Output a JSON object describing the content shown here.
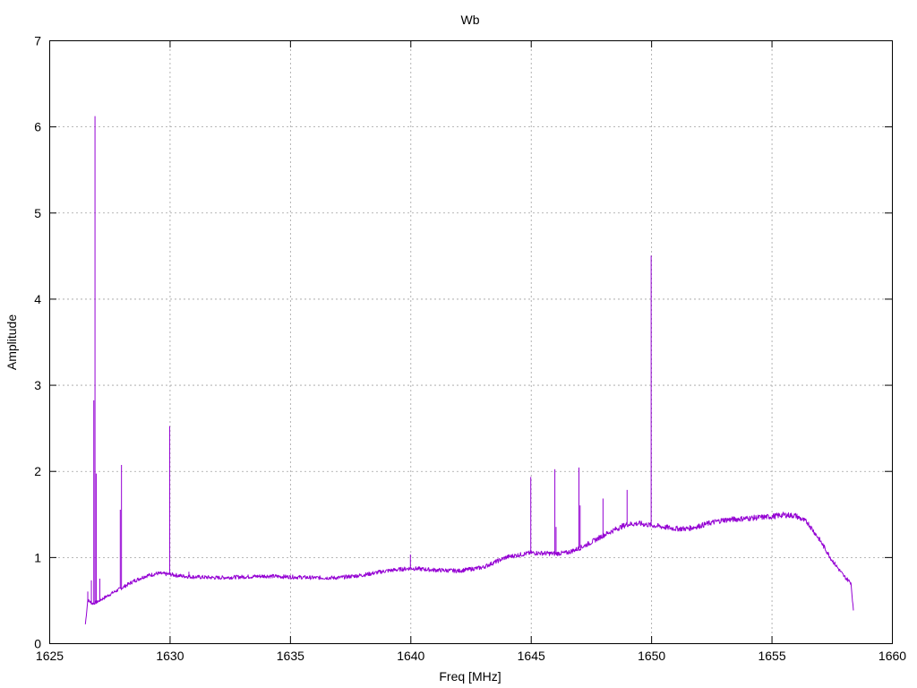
{
  "chart_data": {
    "type": "line",
    "title": "Wb",
    "xlabel": "Freq [MHz]",
    "ylabel": "Amplitude",
    "xlim": [
      1625,
      1660
    ],
    "ylim": [
      0,
      7
    ],
    "xticks": [
      1625,
      1630,
      1635,
      1640,
      1645,
      1650,
      1655,
      1660
    ],
    "yticks": [
      0,
      1,
      2,
      3,
      4,
      5,
      6,
      7
    ],
    "grid": true,
    "legend": "none",
    "color": "#9400d3",
    "series": [
      {
        "values": [
          [
            1626.5,
            0.22
          ],
          [
            1626.6,
            0.5
          ],
          [
            1626.8,
            0.46
          ],
          [
            1627.0,
            0.48
          ],
          [
            1627.3,
            0.53
          ],
          [
            1627.6,
            0.58
          ],
          [
            1628.0,
            0.64
          ],
          [
            1628.5,
            0.72
          ],
          [
            1629.0,
            0.78
          ],
          [
            1629.5,
            0.81
          ],
          [
            1630.0,
            0.8
          ],
          [
            1630.5,
            0.78
          ],
          [
            1631.0,
            0.77
          ],
          [
            1632.0,
            0.76
          ],
          [
            1633.0,
            0.77
          ],
          [
            1634.0,
            0.78
          ],
          [
            1635.0,
            0.77
          ],
          [
            1636.0,
            0.76
          ],
          [
            1637.0,
            0.76
          ],
          [
            1638.0,
            0.79
          ],
          [
            1639.0,
            0.84
          ],
          [
            1640.0,
            0.87
          ],
          [
            1641.0,
            0.85
          ],
          [
            1642.0,
            0.84
          ],
          [
            1643.0,
            0.88
          ],
          [
            1644.0,
            1.0
          ],
          [
            1645.0,
            1.05
          ],
          [
            1646.0,
            1.04
          ],
          [
            1646.5,
            1.05
          ],
          [
            1647.0,
            1.1
          ],
          [
            1647.5,
            1.17
          ],
          [
            1648.0,
            1.25
          ],
          [
            1648.5,
            1.32
          ],
          [
            1649.0,
            1.38
          ],
          [
            1649.5,
            1.39
          ],
          [
            1650.0,
            1.37
          ],
          [
            1650.5,
            1.35
          ],
          [
            1651.0,
            1.33
          ],
          [
            1651.5,
            1.33
          ],
          [
            1652.0,
            1.36
          ],
          [
            1652.5,
            1.4
          ],
          [
            1653.0,
            1.43
          ],
          [
            1653.5,
            1.44
          ],
          [
            1654.0,
            1.45
          ],
          [
            1654.5,
            1.46
          ],
          [
            1655.0,
            1.47
          ],
          [
            1655.5,
            1.49
          ],
          [
            1656.0,
            1.48
          ],
          [
            1656.5,
            1.4
          ],
          [
            1657.0,
            1.2
          ],
          [
            1657.5,
            0.97
          ],
          [
            1658.0,
            0.78
          ],
          [
            1658.3,
            0.7
          ],
          [
            1658.4,
            0.38
          ]
        ],
        "spikes": [
          [
            1626.6,
            0.6
          ],
          [
            1626.75,
            0.73
          ],
          [
            1626.85,
            2.82
          ],
          [
            1626.9,
            6.12
          ],
          [
            1626.95,
            1.97
          ],
          [
            1627.1,
            0.75
          ],
          [
            1627.95,
            1.55
          ],
          [
            1628.0,
            2.07
          ],
          [
            1630.0,
            2.52
          ],
          [
            1630.8,
            0.83
          ],
          [
            1640.0,
            1.03
          ],
          [
            1645.0,
            1.93
          ],
          [
            1646.0,
            2.02
          ],
          [
            1646.05,
            1.35
          ],
          [
            1647.0,
            2.04
          ],
          [
            1647.05,
            1.6
          ],
          [
            1648.0,
            1.68
          ],
          [
            1649.0,
            1.78
          ],
          [
            1650.0,
            4.5
          ]
        ]
      }
    ]
  }
}
